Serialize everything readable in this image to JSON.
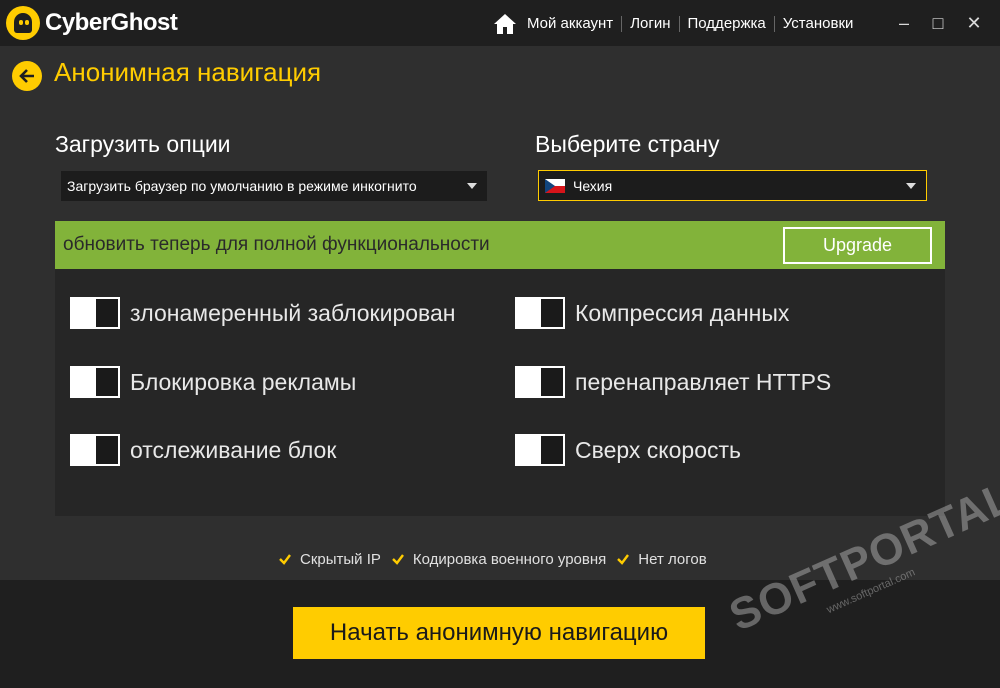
{
  "app": {
    "name": "CyberGhost"
  },
  "topnav": {
    "items": [
      "Мой аккаунт",
      "Логин",
      "Поддержка",
      "Установки"
    ]
  },
  "window": {
    "minimize": "–",
    "maximize": "□",
    "close": "✕"
  },
  "header": {
    "title": "Анонимная навигация"
  },
  "load_options": {
    "label": "Загрузить опции",
    "value": "Загрузить браузер по умолчанию в режиме инкогнито"
  },
  "country": {
    "label": "Выберите страну",
    "value": "Чехия"
  },
  "upgrade": {
    "text": "обновить теперь для полной функциональности",
    "button": "Upgrade"
  },
  "options": {
    "left": [
      "злонамеренный заблокирован",
      "Блокировка рекламы",
      "отслеживание блок"
    ],
    "right": [
      "Компрессия данных",
      "перенаправляет HTTPS",
      "Сверх скорость"
    ]
  },
  "features": [
    "Скрытый IP",
    "Кодировка военного уровня",
    "Нет логов"
  ],
  "start_button": "Начать анонимную навигацию",
  "watermark": {
    "main": "SOFTPORTAL",
    "sub": "www.softportal.com"
  },
  "colors": {
    "accent": "#ffcc00",
    "upgrade_green": "#82b33a",
    "background": "#2f2f2f"
  }
}
